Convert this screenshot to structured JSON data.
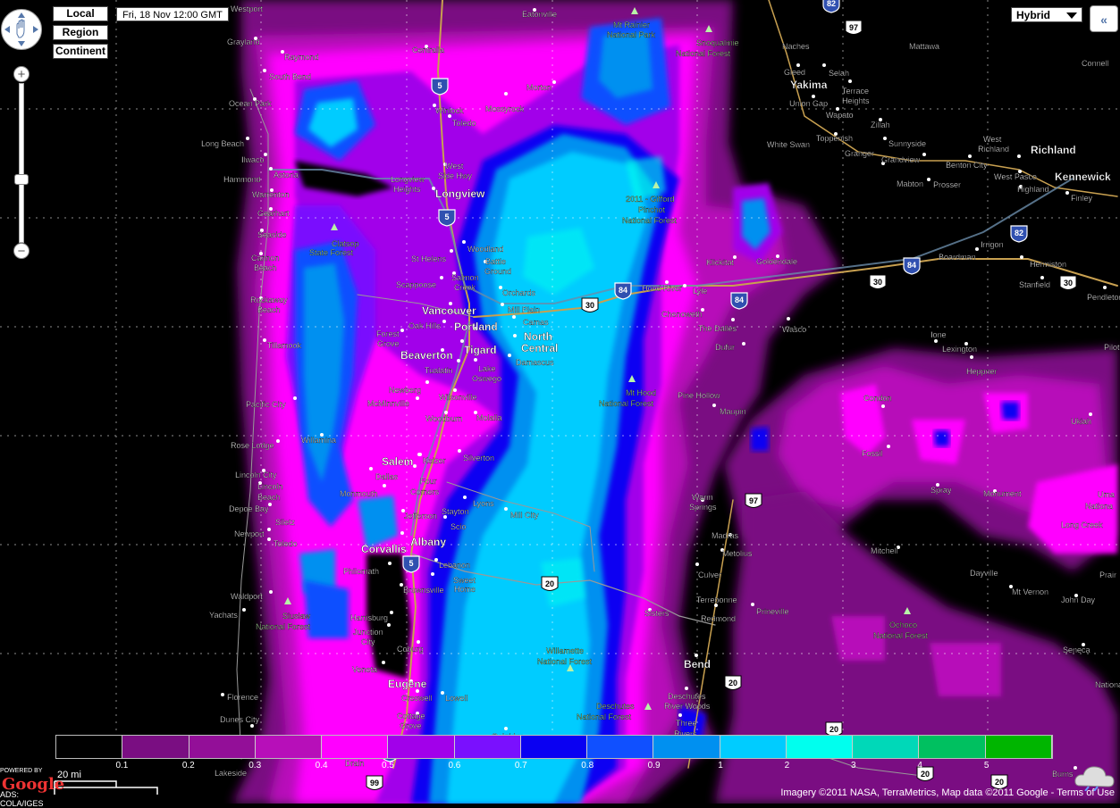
{
  "scale_buttons": [
    "Local",
    "Region",
    "Continent"
  ],
  "forecast_time": "Fri, 18 Nov 12:00 GMT",
  "map_type": {
    "selected": "Hybrid"
  },
  "controls": {
    "zoom_in": "+",
    "zoom_out": "−",
    "collapse": "«"
  },
  "legend": {
    "colors": [
      "#000000",
      "#7a0e82",
      "#930f98",
      "#b70fb9",
      "#ff00ff",
      "#a200ea",
      "#7a10fe",
      "#0a00f2",
      "#1050ff",
      "#0090f0",
      "#00ccff",
      "#00ffee",
      "#00d8b8",
      "#00c060",
      "#00b500"
    ],
    "labels": [
      "0.1",
      "0.2",
      "0.3",
      "0.4",
      "0.5",
      "0.6",
      "0.7",
      "0.8",
      "0.9",
      "1",
      "2",
      "3",
      "4",
      "5"
    ]
  },
  "scale_bar": {
    "label": "20 mi"
  },
  "attribution": {
    "text": "Imagery ©2011 NASA, TerraMetrics, Map data ©2011 Google",
    "terms": "Terms of Use"
  },
  "google_mark": {
    "powered": "POWERED BY",
    "logo": "Google",
    "source": "ADS: COLA/IGES"
  },
  "map_labels": [
    {
      "text": "Westport",
      "c": "w"
    },
    {
      "text": "Grayland",
      "c": "w"
    },
    {
      "text": "Raymond",
      "c": "w"
    },
    {
      "text": "South Bend",
      "c": "w"
    },
    {
      "text": "Ocean Park",
      "c": "w"
    },
    {
      "text": "Long Beach",
      "c": "w"
    },
    {
      "text": "Ilwaco",
      "c": "w"
    },
    {
      "text": "Astoria",
      "c": "w"
    },
    {
      "text": "Hammond",
      "c": "w"
    },
    {
      "text": "Warrenton",
      "c": "w"
    },
    {
      "text": "Gearhart",
      "c": "w"
    },
    {
      "text": "Seaside",
      "c": "w"
    },
    {
      "text": "Cannon",
      "c": "w"
    },
    {
      "text": "Beach",
      "c": "w"
    },
    {
      "text": "Rockaway",
      "c": "w"
    },
    {
      "text": "Beach",
      "c": "w"
    },
    {
      "text": "Tillamook",
      "c": "w"
    },
    {
      "text": "Pacific City",
      "c": "w"
    },
    {
      "text": "Rose Lodge",
      "c": "w"
    },
    {
      "text": "Lincoln City",
      "c": "w"
    },
    {
      "text": "Lincoln",
      "c": "w"
    },
    {
      "text": "Beach",
      "c": "w"
    },
    {
      "text": "Depoe Bay",
      "c": "w"
    },
    {
      "text": "Siletz",
      "c": "w"
    },
    {
      "text": "Newport",
      "c": "w"
    },
    {
      "text": "Toledo",
      "c": "w"
    },
    {
      "text": "Waldport",
      "c": "w"
    },
    {
      "text": "Yachats",
      "c": "w"
    },
    {
      "text": "Florence",
      "c": "w"
    },
    {
      "text": "Dunes City",
      "c": "w"
    },
    {
      "text": "Reedsport",
      "c": "w"
    },
    {
      "text": "Lakeside",
      "c": "w"
    },
    {
      "text": "Eatonville",
      "c": "w"
    },
    {
      "text": "Centralia",
      "c": "w"
    },
    {
      "text": "Morton",
      "c": "w"
    },
    {
      "text": "Winlock",
      "c": "w"
    },
    {
      "text": "Mossyrock",
      "c": "w"
    },
    {
      "text": "Toledo",
      "c": "w"
    },
    {
      "text": "West",
      "c": "w"
    },
    {
      "text": "Side Hwy",
      "c": "w"
    },
    {
      "text": "Longview",
      "c": "w"
    },
    {
      "text": "Heights",
      "c": "w"
    },
    {
      "text": "Longview",
      "c": "wb"
    },
    {
      "text": "Woodland",
      "c": "w"
    },
    {
      "text": "Battle",
      "c": "w"
    },
    {
      "text": "Ground",
      "c": "w"
    },
    {
      "text": "St Helens",
      "c": "w"
    },
    {
      "text": "Salmon",
      "c": "w"
    },
    {
      "text": "Creek",
      "c": "w"
    },
    {
      "text": "Scappoose",
      "c": "w"
    },
    {
      "text": "Orchards",
      "c": "w"
    },
    {
      "text": "Vancouver",
      "c": "wb"
    },
    {
      "text": "Mill Plain",
      "c": "w"
    },
    {
      "text": "Camas",
      "c": "w"
    },
    {
      "text": "Portland",
      "c": "wb"
    },
    {
      "text": "Oak Hills",
      "c": "w"
    },
    {
      "text": "North",
      "c": "wb"
    },
    {
      "text": "Central",
      "c": "wb"
    },
    {
      "text": "Forest",
      "c": "w"
    },
    {
      "text": "Grove",
      "c": "w"
    },
    {
      "text": "Tigard",
      "c": "wb"
    },
    {
      "text": "Beaverton",
      "c": "wb"
    },
    {
      "text": "Damascus",
      "c": "w"
    },
    {
      "text": "Tualatin",
      "c": "w"
    },
    {
      "text": "Lake",
      "c": "w"
    },
    {
      "text": "Oswego",
      "c": "w"
    },
    {
      "text": "Newberg",
      "c": "w"
    },
    {
      "text": "Wilsonville",
      "c": "w"
    },
    {
      "text": "McMinnville",
      "c": "w"
    },
    {
      "text": "Woodburn",
      "c": "w"
    },
    {
      "text": "Molalla",
      "c": "w"
    },
    {
      "text": "Willamina",
      "c": "w"
    },
    {
      "text": "Salem",
      "c": "wb"
    },
    {
      "text": "Keizer",
      "c": "w"
    },
    {
      "text": "Silverton",
      "c": "w"
    },
    {
      "text": "Dallas",
      "c": "w"
    },
    {
      "text": "Four",
      "c": "w"
    },
    {
      "text": "Corners",
      "c": "w"
    },
    {
      "text": "Monmouth",
      "c": "w"
    },
    {
      "text": "Lyons",
      "c": "w"
    },
    {
      "text": "Jefferson",
      "c": "w"
    },
    {
      "text": "Stayton",
      "c": "w"
    },
    {
      "text": "Mill City",
      "c": "w"
    },
    {
      "text": "Scio",
      "c": "w"
    },
    {
      "text": "Albany",
      "c": "wb"
    },
    {
      "text": "Corvallis",
      "c": "wb"
    },
    {
      "text": "Lebanon",
      "c": "w"
    },
    {
      "text": "Philomath",
      "c": "w"
    },
    {
      "text": "Sweet",
      "c": "w"
    },
    {
      "text": "Home",
      "c": "w"
    },
    {
      "text": "Brownsville",
      "c": "w"
    },
    {
      "text": "Harrisburg",
      "c": "w"
    },
    {
      "text": "Junction",
      "c": "w"
    },
    {
      "text": "City",
      "c": "w"
    },
    {
      "text": "Coburg",
      "c": "w"
    },
    {
      "text": "Veneta",
      "c": "w"
    },
    {
      "text": "Eugene",
      "c": "wb"
    },
    {
      "text": "Creswell",
      "c": "w"
    },
    {
      "text": "Lowell",
      "c": "w"
    },
    {
      "text": "Cottage",
      "c": "w"
    },
    {
      "text": "Grove",
      "c": "w"
    },
    {
      "text": "Oakridge",
      "c": "w"
    },
    {
      "text": "Drain",
      "c": "w"
    },
    {
      "text": "Mt Rainier",
      "c": "g"
    },
    {
      "text": "National Park",
      "c": "g"
    },
    {
      "text": "Snoqualmie",
      "c": "g"
    },
    {
      "text": "National Forest",
      "c": "g"
    },
    {
      "text": "2011 - Gifford",
      "c": "g"
    },
    {
      "text": "Pinchot",
      "c": "g"
    },
    {
      "text": "National Forest",
      "c": "g"
    },
    {
      "text": "Clatsop",
      "c": "g"
    },
    {
      "text": "State Forest",
      "c": "g"
    },
    {
      "text": "Mt Hood",
      "c": "g"
    },
    {
      "text": "National Forest",
      "c": "g"
    },
    {
      "text": "Siuslaw",
      "c": "g"
    },
    {
      "text": "National Forest",
      "c": "g"
    },
    {
      "text": "Willamette",
      "c": "g"
    },
    {
      "text": "National Forest",
      "c": "g"
    },
    {
      "text": "Deschutes",
      "c": "g"
    },
    {
      "text": "National Forest",
      "c": "g"
    },
    {
      "text": "Ochoco",
      "c": "g"
    },
    {
      "text": "National Forest",
      "c": "g"
    },
    {
      "text": "Naches",
      "c": "w"
    },
    {
      "text": "Gleed",
      "c": "w"
    },
    {
      "text": "Selah",
      "c": "w"
    },
    {
      "text": "Yakima",
      "c": "wb"
    },
    {
      "text": "Terrace",
      "c": "w"
    },
    {
      "text": "Heights",
      "c": "w"
    },
    {
      "text": "Union Gap",
      "c": "w"
    },
    {
      "text": "Wapato",
      "c": "w"
    },
    {
      "text": "Zillah",
      "c": "w"
    },
    {
      "text": "Toppenish",
      "c": "w"
    },
    {
      "text": "White Swan",
      "c": "w"
    },
    {
      "text": "Granger",
      "c": "w"
    },
    {
      "text": "Sunnyside",
      "c": "w"
    },
    {
      "text": "Grandview",
      "c": "w"
    },
    {
      "text": "Mabton",
      "c": "w"
    },
    {
      "text": "Prosser",
      "c": "w"
    },
    {
      "text": "Mattawa",
      "c": "w"
    },
    {
      "text": "Connell",
      "c": "w"
    },
    {
      "text": "West",
      "c": "w"
    },
    {
      "text": "Richland",
      "c": "w"
    },
    {
      "text": "Richland",
      "c": "wb"
    },
    {
      "text": "Benton City",
      "c": "w"
    },
    {
      "text": "West Pasco",
      "c": "w"
    },
    {
      "text": "Kennewick",
      "c": "wb"
    },
    {
      "text": "Highland",
      "c": "w"
    },
    {
      "text": "Finley",
      "c": "w"
    },
    {
      "text": "Irrigon",
      "c": "w"
    },
    {
      "text": "Boardman",
      "c": "w"
    },
    {
      "text": "Hermiston",
      "c": "w"
    },
    {
      "text": "Stanfield",
      "c": "w"
    },
    {
      "text": "Pendleton",
      "c": "w"
    },
    {
      "text": "Klickitat",
      "c": "w"
    },
    {
      "text": "Goldendale",
      "c": "w"
    },
    {
      "text": "Hood River",
      "c": "w"
    },
    {
      "text": "Lyle",
      "c": "w"
    },
    {
      "text": "Chenoweth",
      "c": "w"
    },
    {
      "text": "The Dalles",
      "c": "w"
    },
    {
      "text": "Wasco",
      "c": "w"
    },
    {
      "text": "Dufur",
      "c": "w"
    },
    {
      "text": "Ione",
      "c": "w"
    },
    {
      "text": "Lexington",
      "c": "w"
    },
    {
      "text": "Heppner",
      "c": "w"
    },
    {
      "text": "Pilot",
      "c": "w"
    },
    {
      "text": "Pine Hollow",
      "c": "w"
    },
    {
      "text": "Maupin",
      "c": "w"
    },
    {
      "text": "Condon",
      "c": "w"
    },
    {
      "text": "Ukiah",
      "c": "w"
    },
    {
      "text": "Fossil",
      "c": "w"
    },
    {
      "text": "Spray",
      "c": "w"
    },
    {
      "text": "Monument",
      "c": "w"
    },
    {
      "text": "Uma",
      "c": "w"
    },
    {
      "text": "Nationa",
      "c": "w"
    },
    {
      "text": "Long Creek",
      "c": "w"
    },
    {
      "text": "Warm",
      "c": "w"
    },
    {
      "text": "Springs",
      "c": "w"
    },
    {
      "text": "Madras",
      "c": "w"
    },
    {
      "text": "Metolius",
      "c": "w"
    },
    {
      "text": "Mitchell",
      "c": "w"
    },
    {
      "text": "Dayville",
      "c": "w"
    },
    {
      "text": "Prair",
      "c": "w"
    },
    {
      "text": "Culver",
      "c": "w"
    },
    {
      "text": "Mt Vernon",
      "c": "w"
    },
    {
      "text": "John Day",
      "c": "w"
    },
    {
      "text": "Terrebonne",
      "c": "w"
    },
    {
      "text": "Redmond",
      "c": "w"
    },
    {
      "text": "Prineville",
      "c": "w"
    },
    {
      "text": "Sisters",
      "c": "w"
    },
    {
      "text": "Seneca",
      "c": "w"
    },
    {
      "text": "Bend",
      "c": "wb"
    },
    {
      "text": "Deschutes",
      "c": "w"
    },
    {
      "text": "River Woods",
      "c": "w"
    },
    {
      "text": "Three",
      "c": "w"
    },
    {
      "text": "Rivers",
      "c": "w"
    },
    {
      "text": "La Pine",
      "c": "w"
    },
    {
      "text": "Burns",
      "c": "w"
    },
    {
      "text": "Nationa",
      "c": "w"
    }
  ],
  "shields": [
    {
      "text": "82",
      "k": "i"
    },
    {
      "text": "97",
      "k": "u"
    },
    {
      "text": "5",
      "k": "i"
    },
    {
      "text": "5",
      "k": "i"
    },
    {
      "text": "84",
      "k": "i"
    },
    {
      "text": "30",
      "k": "u"
    },
    {
      "text": "84",
      "k": "i"
    },
    {
      "text": "84",
      "k": "i"
    },
    {
      "text": "30",
      "k": "u"
    },
    {
      "text": "82",
      "k": "i"
    },
    {
      "text": "30",
      "k": "u"
    },
    {
      "text": "97",
      "k": "u"
    },
    {
      "text": "5",
      "k": "i"
    },
    {
      "text": "20",
      "k": "u"
    },
    {
      "text": "20",
      "k": "u"
    },
    {
      "text": "20",
      "k": "u"
    },
    {
      "text": "5",
      "k": "i"
    },
    {
      "text": "99",
      "k": "u"
    },
    {
      "text": "20",
      "k": "u"
    },
    {
      "text": "20",
      "k": "u"
    }
  ]
}
